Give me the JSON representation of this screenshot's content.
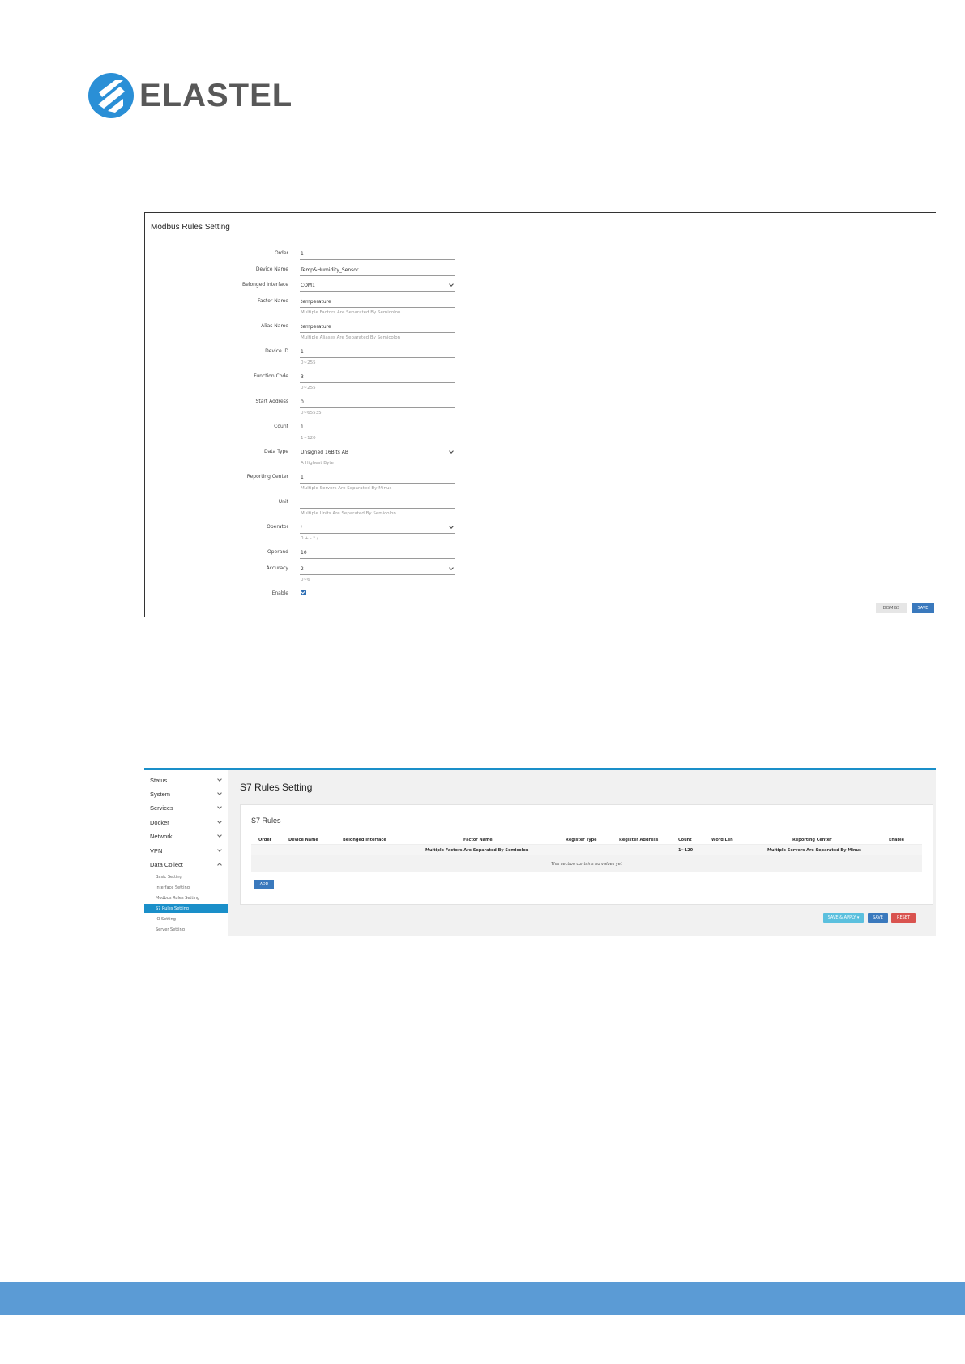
{
  "brand": {
    "name": "ELASTEL",
    "color": "#2a8fd6"
  },
  "modbus": {
    "title": "Modbus Rules Setting",
    "fields": [
      {
        "label": "Order",
        "value": "1",
        "hint": ""
      },
      {
        "label": "Device Name",
        "value": "Temp&Humidity_Sensor",
        "hint": ""
      },
      {
        "label": "Belonged Interface",
        "value": "COM1",
        "hint": ""
      },
      {
        "label": "Factor Name",
        "value": "temperature",
        "hint": "Multiple Factors Are Separated By Semicolon"
      },
      {
        "label": "Alias Name",
        "value": "temperature",
        "hint": "Multiple Aliases Are Separated By Semicolon"
      },
      {
        "label": "Device ID",
        "value": "1",
        "hint": "0~255"
      },
      {
        "label": "Function Code",
        "value": "3",
        "hint": "0~255"
      },
      {
        "label": "Start Address",
        "value": "0",
        "hint": "0~65535"
      },
      {
        "label": "Count",
        "value": "1",
        "hint": "1~120"
      },
      {
        "label": "Data Type",
        "value": "Unsigned 16Bits AB",
        "hint": "A Highest Byte"
      },
      {
        "label": "Reporting Center",
        "value": "1",
        "hint": "Multiple Servers Are Separated By Minus"
      },
      {
        "label": "Unit",
        "value": "",
        "hint": "Multiple Units Are Separated By Semicolon"
      },
      {
        "label": "Operator",
        "value": "/",
        "hint": "0 + - * /"
      },
      {
        "label": "Operand",
        "value": "10",
        "hint": ""
      },
      {
        "label": "Accuracy",
        "value": "2",
        "hint": "0~6"
      },
      {
        "label": "Enable",
        "value": "",
        "hint": ""
      }
    ],
    "dismiss_label": "DISMISS",
    "save_label": "SAVE"
  },
  "s7": {
    "nav": [
      {
        "label": "Status"
      },
      {
        "label": "System"
      },
      {
        "label": "Services"
      },
      {
        "label": "Docker"
      },
      {
        "label": "Network"
      },
      {
        "label": "VPN"
      },
      {
        "label": "Data Collect"
      }
    ],
    "subnav": [
      {
        "label": "Basic Setting"
      },
      {
        "label": "Interface Setting"
      },
      {
        "label": "Modbus Rules Setting"
      },
      {
        "label": "S7 Rules Setting"
      },
      {
        "label": "IO Setting"
      },
      {
        "label": "Server Setting"
      }
    ],
    "page_title": "S7 Rules Setting",
    "section_title": "S7 Rules",
    "columns": [
      "Order",
      "Device Name",
      "Belonged Interface",
      "Factor Name",
      "Register Type",
      "Register Address",
      "Count",
      "Word Len",
      "Reporting Center",
      "Enable"
    ],
    "column_notes": {
      "factor": "Multiple Factors Are Separated By Semicolon",
      "count": "1~120",
      "reporting": "Multiple Servers Are Separated By Minus"
    },
    "empty_text": "This section contains no values yet",
    "add_label": "ADD",
    "save_apply_label": "SAVE & APPLY ▾",
    "save_label": "SAVE",
    "reset_label": "RESET"
  }
}
